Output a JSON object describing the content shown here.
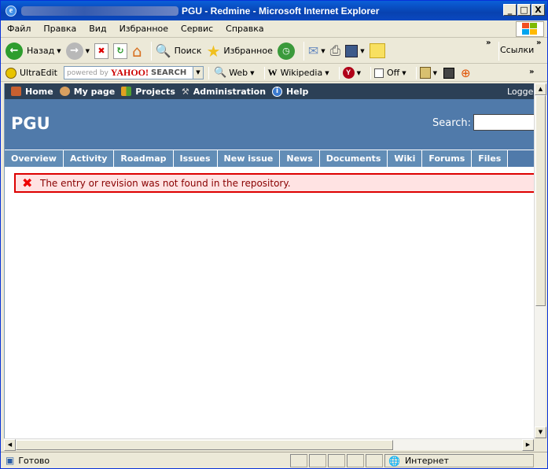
{
  "window": {
    "title": "PGU - Redmine - Microsoft Internet Explorer",
    "buttons": {
      "minimize": "_",
      "maximize": "□",
      "close": "X"
    }
  },
  "menu": [
    "Файл",
    "Правка",
    "Вид",
    "Избранное",
    "Сервис",
    "Справка"
  ],
  "toolbar": {
    "back": "Назад",
    "search": "Поиск",
    "favorites": "Избранное",
    "links": "Ссылки"
  },
  "toolbar2": {
    "ultraedit": "UltraEdit",
    "yahoo_powered": "powered by",
    "yahoo_brand": "YAHOO!",
    "yahoo_search": "SEARCH",
    "web": "Web",
    "wikipedia": "Wikipedia",
    "off": "Off"
  },
  "redmine": {
    "top_menu": [
      "Home",
      "My page",
      "Projects",
      "Administration",
      "Help"
    ],
    "logged": "Logge",
    "project_title": "PGU",
    "search_label": "Search:",
    "tabs": [
      "Overview",
      "Activity",
      "Roadmap",
      "Issues",
      "New issue",
      "News",
      "Documents",
      "Wiki",
      "Forums",
      "Files"
    ],
    "error": "The entry or revision was not found in the repository."
  },
  "status": {
    "left": "Готово",
    "zone": "Интернет"
  },
  "colors": {
    "top_menu_bg": "#2c4056",
    "header_bg": "#507aaa",
    "tab_bg": "#628db6",
    "error_bg": "#ffe3e3",
    "error_border": "#dd0000"
  }
}
